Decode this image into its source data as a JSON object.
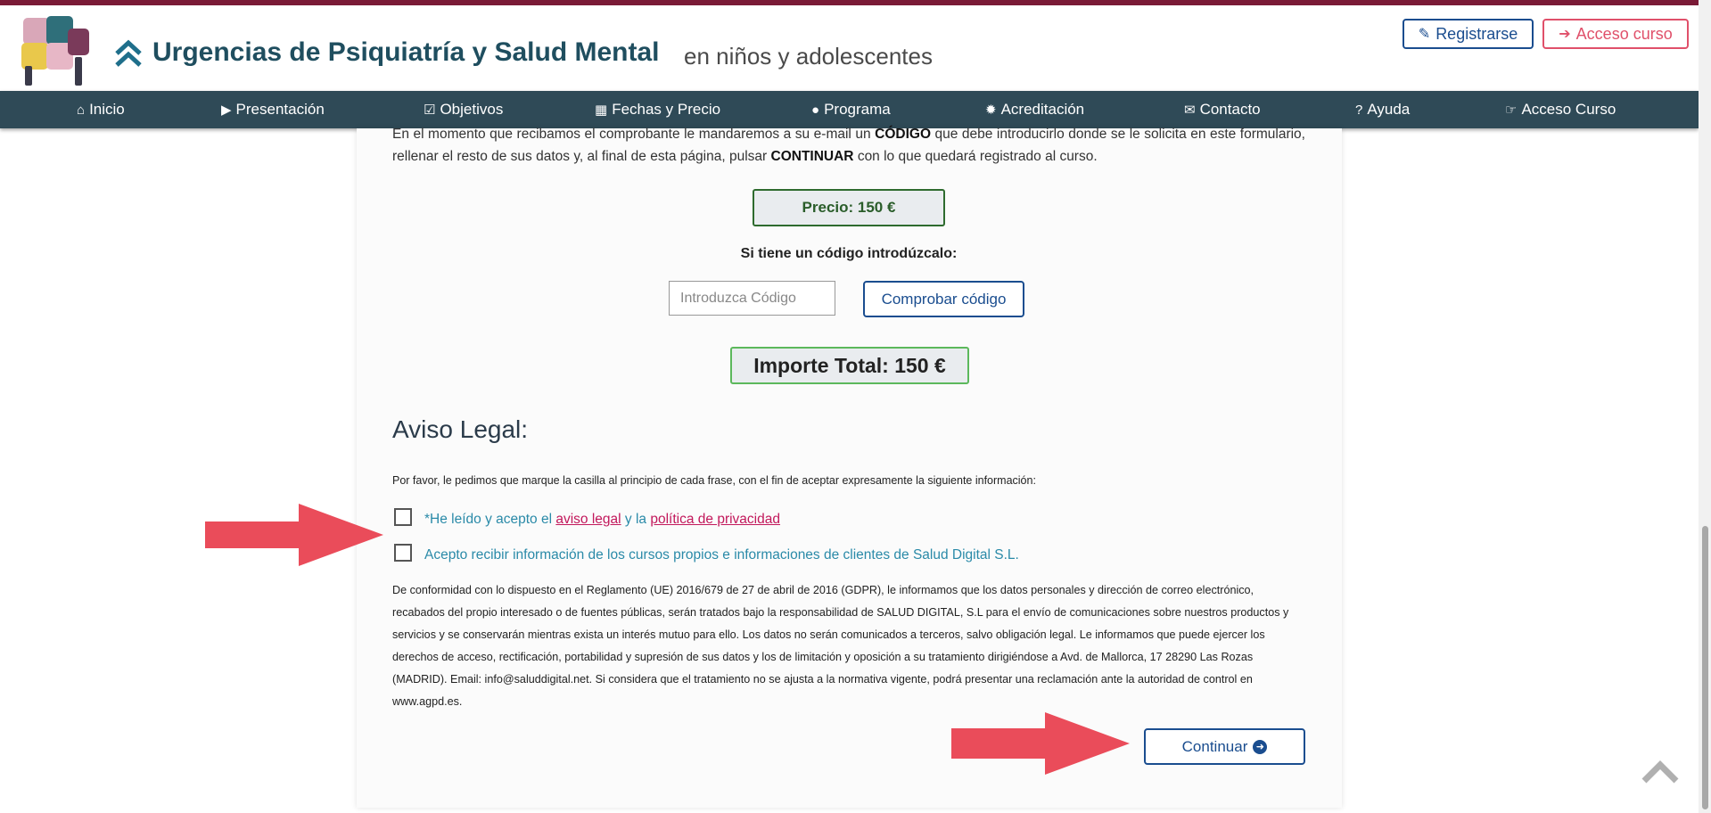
{
  "header": {
    "title": "Urgencias de Psiquiatría y Salud Mental",
    "subtitle": "en niños y adolescentes",
    "register_label": "Registrarse",
    "access_label": "Acceso curso"
  },
  "nav": {
    "items": [
      {
        "label": "Inicio",
        "icon": "home-icon"
      },
      {
        "label": "Presentación",
        "icon": "video-camera-icon"
      },
      {
        "label": "Objetivos",
        "icon": "checkbox-icon"
      },
      {
        "label": "Fechas y Precio",
        "icon": "calendar-icon"
      },
      {
        "label": "Programa",
        "icon": "user-icon"
      },
      {
        "label": "Acreditación",
        "icon": "certificate-icon"
      },
      {
        "label": "Contacto",
        "icon": "envelope-icon"
      },
      {
        "label": "Ayuda",
        "icon": "question-circle-icon"
      },
      {
        "label": "Acceso Curso",
        "icon": "hand-pointer-icon"
      }
    ]
  },
  "main": {
    "intro_part1": "En el momento que recibamos el comprobante le mandaremos a su e-mail un",
    "intro_bold1": "CÓDIGO",
    "intro_part2": "que debe introducirlo donde se le solicita en este formulario, rellenar el resto de sus datos y, al final de esta página, pulsar",
    "intro_bold2": "CONTINUAR",
    "intro_part3": "con lo que quedará registrado al curso.",
    "price_label": "Precio: 150 €",
    "code_prompt": "Si tiene un código introdúzcalo:",
    "code_placeholder": "Introduzca Código",
    "check_code_label": "Comprobar código",
    "total_label": "Importe Total: 150 €"
  },
  "legal": {
    "title": "Aviso Legal:",
    "instructions": "Por favor, le pedimos que marque la casilla al principio de cada frase, con el fin de aceptar expresamente la siguiente información:",
    "consent1_prefix": "*He leído y acepto el",
    "consent1_link1": "aviso legal",
    "consent1_mid": "y la",
    "consent1_link2": "política de privacidad",
    "consent2": "Acepto recibir información de los cursos propios e informaciones de clientes de Salud Digital S.L.",
    "gdpr_text": "De conformidad con lo dispuesto en el Reglamento (UE) 2016/679 de 27 de abril de 2016 (GDPR), le informamos que los datos personales y dirección de correo electrónico, recabados del propio interesado o de fuentes públicas, serán tratados bajo la responsabilidad de SALUD DIGITAL, S.L para el envío de comunicaciones sobre nuestros productos y servicios y se conservarán mientras exista un interés mutuo para ello. Los datos no serán comunicados a terceros, salvo obligación legal. Le informamos que puede ejercer los derechos de acceso, rectificación, portabilidad y supresión de sus datos y los de limitación y oposición a su tratamiento dirigiéndose a Avd. de Mallorca, 17 28290 Las Rozas (MADRID). Email: info@saluddigital.net. Si considera que el tratamiento no se ajusta a la normativa vigente, podrá presentar una reclamación ante la autoridad de control en www.agpd.es.",
    "continue_label": "Continuar"
  },
  "colors": {
    "nav_bg": "#2f4a57",
    "title": "#1f4e5f",
    "accent_blue": "#1a4d8f",
    "accent_red": "#e0506a",
    "price_green": "#2e6b2e",
    "annotation_arrow": "#ea4c5a",
    "link_pink": "#c2185b",
    "consent_teal": "#2a8aa8"
  }
}
